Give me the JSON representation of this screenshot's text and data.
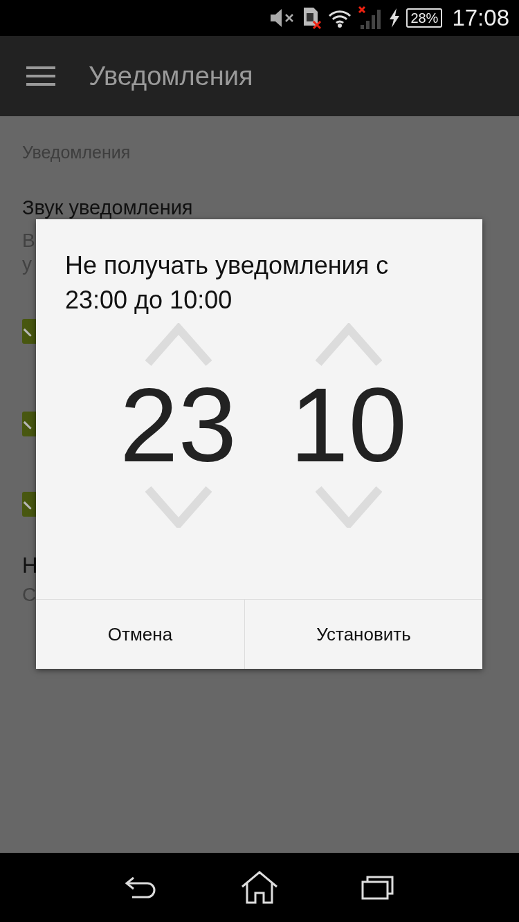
{
  "status_bar": {
    "battery": "28%",
    "time": "17:08"
  },
  "app_bar": {
    "title": "Уведомления"
  },
  "settings": {
    "section": "Уведомления",
    "sound_title": "Звук уведомления",
    "sound_summary_lines": [
      "В",
      "у"
    ],
    "checkboxes": [
      {
        "checked": true
      },
      {
        "checked": true
      },
      {
        "checked": true
      }
    ],
    "item_title": "Н",
    "item_summary": "С"
  },
  "dialog": {
    "title": "Не получать уведомления с 23:00 до 10:00",
    "pickers": [
      {
        "value": "23"
      },
      {
        "value": "10"
      }
    ],
    "buttons": [
      "Отмена",
      "Установить"
    ]
  }
}
